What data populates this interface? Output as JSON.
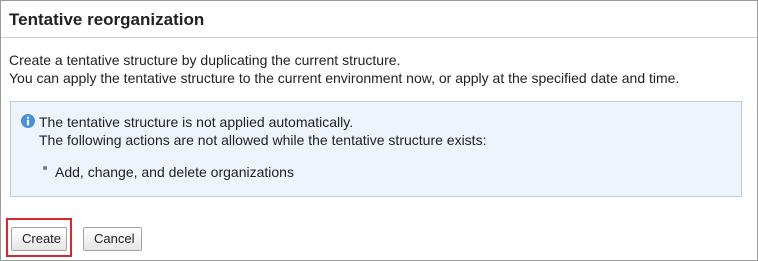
{
  "page": {
    "title": "Tentative reorganization",
    "description_lines": [
      "Create a tentative structure by duplicating the current structure.",
      "You can apply the tentative structure to the current environment now, or apply at the specified date and time."
    ]
  },
  "notice": {
    "icon": "info-icon",
    "line1": "The tentative structure is not applied automatically.",
    "line2": "The following actions are not allowed while the tentative structure exists:",
    "items": [
      "Add, change, and delete organizations"
    ],
    "background_color": "#eef4fb",
    "border_color": "#b7cde4",
    "icon_color": "#4a90d9"
  },
  "buttons": {
    "create_label": "Create",
    "cancel_label": "Cancel"
  },
  "highlight": {
    "target": "create-button",
    "color": "#d9272e"
  }
}
